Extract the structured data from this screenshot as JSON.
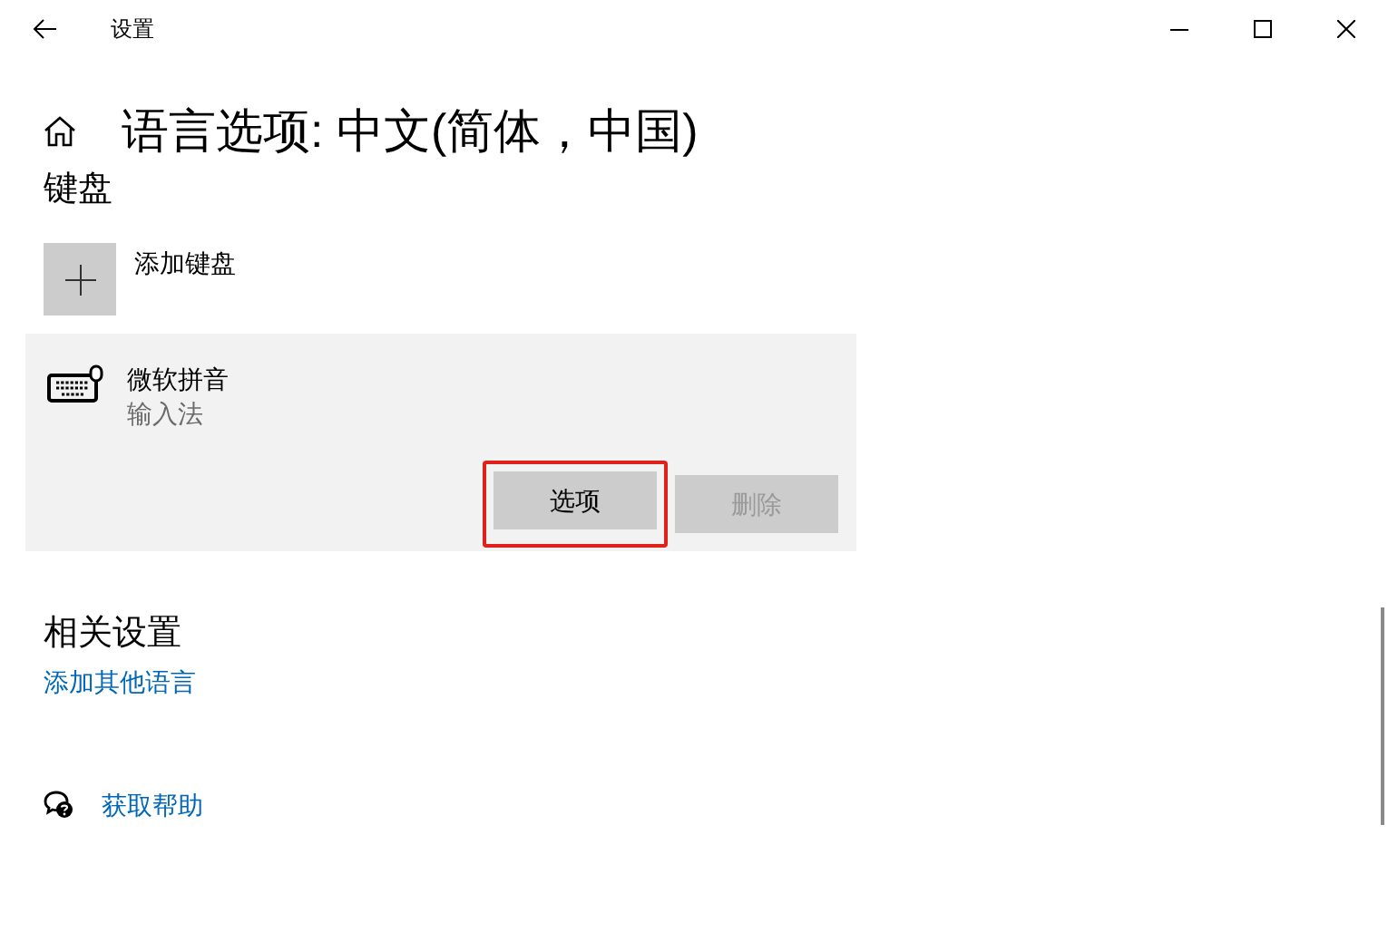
{
  "window": {
    "title": "设置"
  },
  "page_title": "语言选项: 中文(简体，中国)",
  "keyboard_section": {
    "heading": "键盘",
    "add_label": "添加键盘",
    "keyboards": [
      {
        "name": "微软拼音",
        "subtitle": "输入法",
        "buttons": [
          {
            "label": "选项",
            "disabled": false,
            "highlighted": true
          },
          {
            "label": "删除",
            "disabled": true,
            "highlighted": false
          }
        ]
      }
    ]
  },
  "related": {
    "heading": "相关设置",
    "links": [
      "添加其他语言"
    ]
  },
  "help": {
    "label": "获取帮助"
  }
}
